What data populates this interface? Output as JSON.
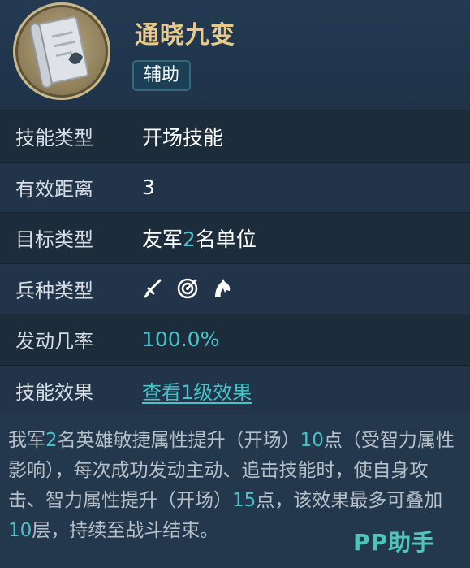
{
  "header": {
    "skill_name": "通晓九变",
    "type_badge": "辅助"
  },
  "rows": {
    "skill_type": {
      "label": "技能类型",
      "value": "开场技能"
    },
    "range": {
      "label": "有效距离",
      "value": "3"
    },
    "target": {
      "label": "目标类型",
      "prefix": "友军",
      "count": "2",
      "suffix": "名单位"
    },
    "troops": {
      "label": "兵种类型",
      "icons": [
        "sword-icon",
        "target-icon",
        "horse-icon"
      ]
    },
    "rate": {
      "label": "发动几率",
      "value": "100.0%"
    },
    "effect": {
      "label": "技能效果",
      "link": "查看1级效果"
    }
  },
  "description": {
    "p1": "我军",
    "n1": "2",
    "p2": "名英雄敏捷属性提升（开场）",
    "n2": "10",
    "p3": "点（受智力属性影响），每次成功发动主动、追击技能时，使自身攻击、智力属性提升（开场）",
    "n3": "15",
    "p4": "点，该效果最多可叠加",
    "n4": "10",
    "p5": "层，持续至战斗结束。"
  },
  "watermark": "PP助手",
  "colors": {
    "highlight": "#49c2c7",
    "title": "#e7c98a"
  }
}
